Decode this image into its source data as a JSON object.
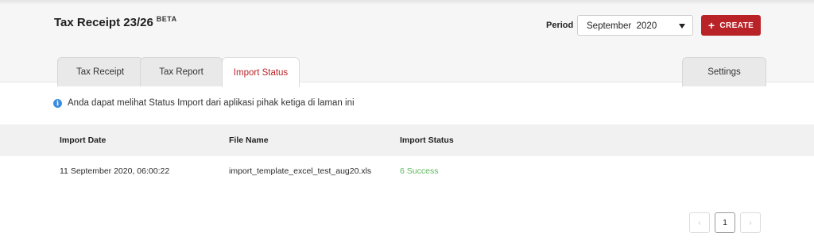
{
  "header": {
    "title": "Tax Receipt 23/26",
    "badge": "BETA",
    "period_label": "Period",
    "period_value": "September  2020",
    "create_label": "CREATE"
  },
  "tabs": [
    {
      "label": "Tax Receipt",
      "active": false
    },
    {
      "label": "Tax Report",
      "active": false
    },
    {
      "label": "Import Status",
      "active": true
    },
    {
      "label": "Settings",
      "active": false
    }
  ],
  "info_message": "Anda dapat melihat Status Import dari aplikasi pihak ketiga di laman ini",
  "table": {
    "columns": [
      "Import Date",
      "File Name",
      "Import Status"
    ],
    "rows": [
      [
        "11 September 2020, 06:00:22",
        "import_template_excel_test_aug20.xls",
        "6 Success"
      ]
    ]
  },
  "pagination": {
    "prev_icon": "chevron-left-icon",
    "current_page": "1",
    "next_icon": "chevron-right-icon"
  },
  "colors": {
    "accent": "#b92327",
    "success": "#5cb85c",
    "info": "#3a8de0"
  }
}
